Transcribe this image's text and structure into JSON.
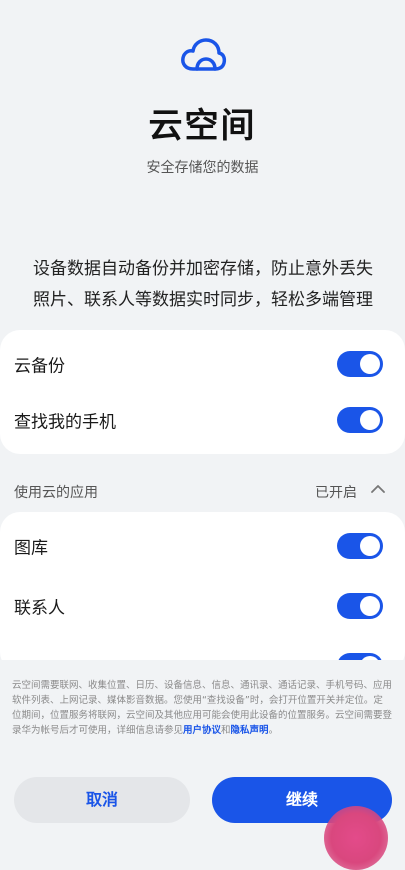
{
  "header": {
    "logo_icon": "cloud-icon",
    "title": "云空间",
    "subtitle": "安全存储您的数据"
  },
  "description": {
    "line1": "设备数据自动备份并加密存储，防止意外丢失",
    "line2": "照片、联系人等数据实时同步，轻松多端管理"
  },
  "main_toggles": [
    {
      "label": "云备份",
      "enabled": true
    },
    {
      "label": "查找我的手机",
      "enabled": true
    }
  ],
  "apps_section": {
    "title": "使用云的应用",
    "status": "已开启",
    "items": [
      {
        "label": "图库",
        "enabled": true
      },
      {
        "label": "联系人",
        "enabled": true
      }
    ]
  },
  "notice": {
    "text": "云空间需要联网、收集位置、日历、设备信息、信息、通讯录、通话记录、手机号码、应用软件列表、上网记录、媒体影音数据。您使用“查找设备”时，会打开位置开关并定位。定位期间，位置服务将联网，云空间及其他应用可能会使用此设备的位置服务。云空间需要登录华为帐号后才可使用，详细信息请参见",
    "link1": "用户协议",
    "conjunction": "和",
    "link2": "隐私声明",
    "end": "。"
  },
  "buttons": {
    "cancel": "取消",
    "continue": "继续"
  },
  "colors": {
    "accent": "#1a55e8",
    "background": "#f1f3f5",
    "card": "#ffffff"
  }
}
